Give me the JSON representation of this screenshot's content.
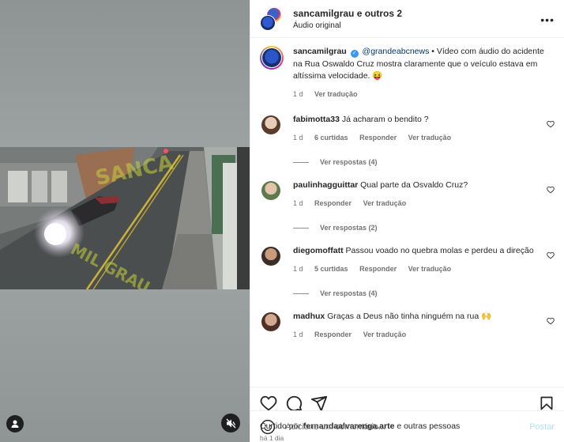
{
  "media": {
    "watermark": "SANCA MIL GRAU",
    "user_tag_icon": "person-icon",
    "mute_icon": "speaker-muted-icon"
  },
  "header": {
    "title": "sancamilgrau e outros 2",
    "subtitle": "Áudio original",
    "more": "•••"
  },
  "caption": {
    "username": "sancamilgrau",
    "mention": "@grandeabcnews",
    "text": " • Vídeo com áudio do acidente na Rua Oswaldo Cruz mostra claramente que o veículo estava em altíssima velocidade. 😝",
    "age": "1 d",
    "translate": "Ver tradução"
  },
  "comments": [
    {
      "username": "fabimotta33",
      "text": "Já acharam o bendito ?",
      "age": "1 d",
      "likes": "6 curtidas",
      "reply": "Responder",
      "translate": "Ver tradução",
      "replies": "Ver respostas (4)",
      "avatar_color": "#d9b9a6"
    },
    {
      "username": "paulinhagguittar",
      "text": "Qual parte da Osvaldo Cruz?",
      "age": "1 d",
      "reply": "Responder",
      "translate": "Ver tradução",
      "replies": "Ver respostas (2)",
      "avatar_color": "#8fa57a"
    },
    {
      "username": "diegomoffatt",
      "text": "Passou voado no quebra molas e perdeu a direção",
      "age": "1 d",
      "likes": "5 curtidas",
      "reply": "Responder",
      "translate": "Ver tradução",
      "replies": "Ver respostas (4)",
      "avatar_color": "#5a4a3c"
    },
    {
      "username": "madhux",
      "text": "Graças a Deus não tinha ninguém na rua 🙌",
      "age": "1 d",
      "reply": "Responder",
      "translate": "Ver tradução",
      "avatar_color": "#6b4a3a"
    }
  ],
  "actions": {
    "like_icon": "heart-icon",
    "comment_icon": "comment-icon",
    "share_icon": "share-icon",
    "save_icon": "bookmark-icon"
  },
  "likes": {
    "prefix": "Curtido por ",
    "user": "fernandaalvarenga.arte",
    "suffix": " e outras pessoas"
  },
  "time": "há 1 dia",
  "add_comment": {
    "placeholder": "Adicione um comentário...",
    "post": "Postar"
  }
}
